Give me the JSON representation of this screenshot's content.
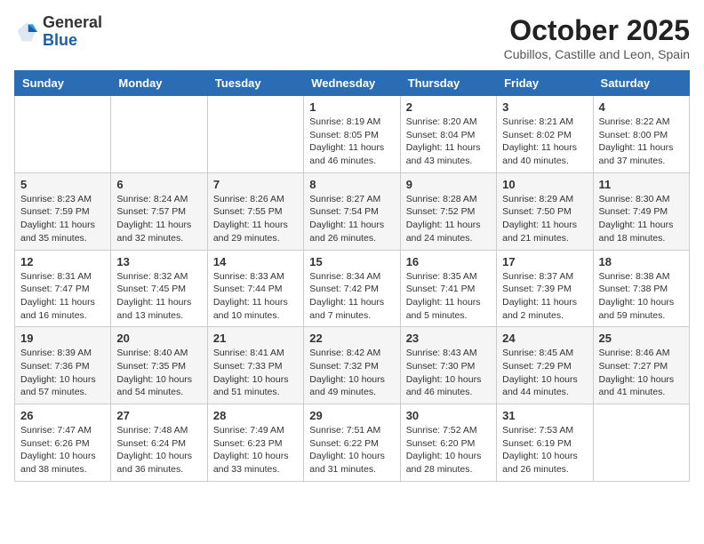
{
  "logo": {
    "general": "General",
    "blue": "Blue"
  },
  "title": "October 2025",
  "location": "Cubillos, Castille and Leon, Spain",
  "days_header": [
    "Sunday",
    "Monday",
    "Tuesday",
    "Wednesday",
    "Thursday",
    "Friday",
    "Saturday"
  ],
  "weeks": [
    [
      {
        "day": "",
        "info": ""
      },
      {
        "day": "",
        "info": ""
      },
      {
        "day": "",
        "info": ""
      },
      {
        "day": "1",
        "info": "Sunrise: 8:19 AM\nSunset: 8:05 PM\nDaylight: 11 hours and 46 minutes."
      },
      {
        "day": "2",
        "info": "Sunrise: 8:20 AM\nSunset: 8:04 PM\nDaylight: 11 hours and 43 minutes."
      },
      {
        "day": "3",
        "info": "Sunrise: 8:21 AM\nSunset: 8:02 PM\nDaylight: 11 hours and 40 minutes."
      },
      {
        "day": "4",
        "info": "Sunrise: 8:22 AM\nSunset: 8:00 PM\nDaylight: 11 hours and 37 minutes."
      }
    ],
    [
      {
        "day": "5",
        "info": "Sunrise: 8:23 AM\nSunset: 7:59 PM\nDaylight: 11 hours and 35 minutes."
      },
      {
        "day": "6",
        "info": "Sunrise: 8:24 AM\nSunset: 7:57 PM\nDaylight: 11 hours and 32 minutes."
      },
      {
        "day": "7",
        "info": "Sunrise: 8:26 AM\nSunset: 7:55 PM\nDaylight: 11 hours and 29 minutes."
      },
      {
        "day": "8",
        "info": "Sunrise: 8:27 AM\nSunset: 7:54 PM\nDaylight: 11 hours and 26 minutes."
      },
      {
        "day": "9",
        "info": "Sunrise: 8:28 AM\nSunset: 7:52 PM\nDaylight: 11 hours and 24 minutes."
      },
      {
        "day": "10",
        "info": "Sunrise: 8:29 AM\nSunset: 7:50 PM\nDaylight: 11 hours and 21 minutes."
      },
      {
        "day": "11",
        "info": "Sunrise: 8:30 AM\nSunset: 7:49 PM\nDaylight: 11 hours and 18 minutes."
      }
    ],
    [
      {
        "day": "12",
        "info": "Sunrise: 8:31 AM\nSunset: 7:47 PM\nDaylight: 11 hours and 16 minutes."
      },
      {
        "day": "13",
        "info": "Sunrise: 8:32 AM\nSunset: 7:45 PM\nDaylight: 11 hours and 13 minutes."
      },
      {
        "day": "14",
        "info": "Sunrise: 8:33 AM\nSunset: 7:44 PM\nDaylight: 11 hours and 10 minutes."
      },
      {
        "day": "15",
        "info": "Sunrise: 8:34 AM\nSunset: 7:42 PM\nDaylight: 11 hours and 7 minutes."
      },
      {
        "day": "16",
        "info": "Sunrise: 8:35 AM\nSunset: 7:41 PM\nDaylight: 11 hours and 5 minutes."
      },
      {
        "day": "17",
        "info": "Sunrise: 8:37 AM\nSunset: 7:39 PM\nDaylight: 11 hours and 2 minutes."
      },
      {
        "day": "18",
        "info": "Sunrise: 8:38 AM\nSunset: 7:38 PM\nDaylight: 10 hours and 59 minutes."
      }
    ],
    [
      {
        "day": "19",
        "info": "Sunrise: 8:39 AM\nSunset: 7:36 PM\nDaylight: 10 hours and 57 minutes."
      },
      {
        "day": "20",
        "info": "Sunrise: 8:40 AM\nSunset: 7:35 PM\nDaylight: 10 hours and 54 minutes."
      },
      {
        "day": "21",
        "info": "Sunrise: 8:41 AM\nSunset: 7:33 PM\nDaylight: 10 hours and 51 minutes."
      },
      {
        "day": "22",
        "info": "Sunrise: 8:42 AM\nSunset: 7:32 PM\nDaylight: 10 hours and 49 minutes."
      },
      {
        "day": "23",
        "info": "Sunrise: 8:43 AM\nSunset: 7:30 PM\nDaylight: 10 hours and 46 minutes."
      },
      {
        "day": "24",
        "info": "Sunrise: 8:45 AM\nSunset: 7:29 PM\nDaylight: 10 hours and 44 minutes."
      },
      {
        "day": "25",
        "info": "Sunrise: 8:46 AM\nSunset: 7:27 PM\nDaylight: 10 hours and 41 minutes."
      }
    ],
    [
      {
        "day": "26",
        "info": "Sunrise: 7:47 AM\nSunset: 6:26 PM\nDaylight: 10 hours and 38 minutes."
      },
      {
        "day": "27",
        "info": "Sunrise: 7:48 AM\nSunset: 6:24 PM\nDaylight: 10 hours and 36 minutes."
      },
      {
        "day": "28",
        "info": "Sunrise: 7:49 AM\nSunset: 6:23 PM\nDaylight: 10 hours and 33 minutes."
      },
      {
        "day": "29",
        "info": "Sunrise: 7:51 AM\nSunset: 6:22 PM\nDaylight: 10 hours and 31 minutes."
      },
      {
        "day": "30",
        "info": "Sunrise: 7:52 AM\nSunset: 6:20 PM\nDaylight: 10 hours and 28 minutes."
      },
      {
        "day": "31",
        "info": "Sunrise: 7:53 AM\nSunset: 6:19 PM\nDaylight: 10 hours and 26 minutes."
      },
      {
        "day": "",
        "info": ""
      }
    ]
  ]
}
